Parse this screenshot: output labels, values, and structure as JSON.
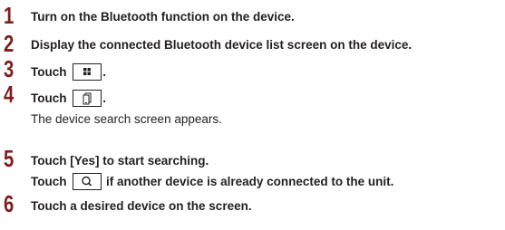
{
  "steps": [
    {
      "number": "1",
      "text": "Turn on the Bluetooth function on the device."
    },
    {
      "number": "2",
      "text": "Display the connected Bluetooth device list screen on the device."
    },
    {
      "number": "3",
      "text_before": "Touch",
      "icon": "grid-menu-icon",
      "text_after": "."
    },
    {
      "number": "4",
      "text_before": "Touch",
      "icon": "phone-icon",
      "text_after": ".",
      "note": "The device search screen appears."
    },
    {
      "number": "5",
      "text": "Touch [Yes] to start searching.",
      "line2_before": "Touch",
      "icon": "search-icon",
      "line2_after": "if another device is already connected to the unit."
    },
    {
      "number": "6",
      "text": "Touch a desired device on the screen."
    }
  ]
}
